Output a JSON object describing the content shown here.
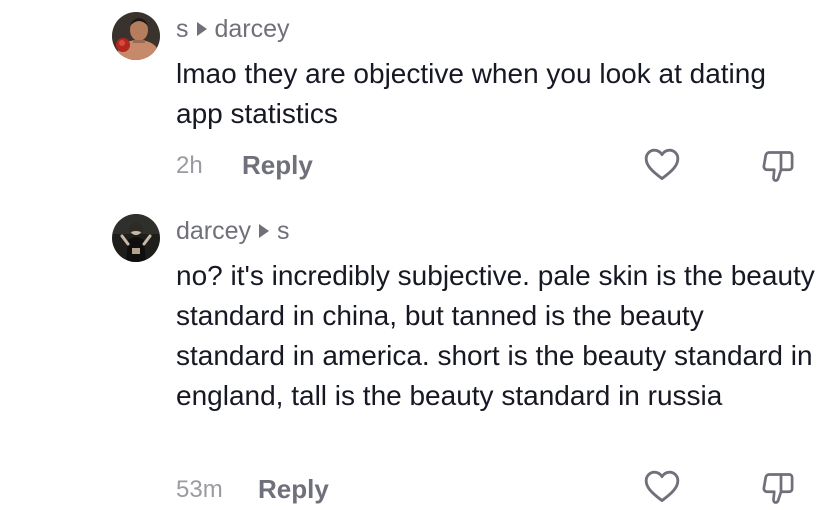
{
  "comments": [
    {
      "author": "s",
      "reply_to": "darcey",
      "text": "lmao they are objective when you look at dating app statistics",
      "time": "2h",
      "reply_label": "Reply",
      "avatar_icon": "boxer-avatar",
      "like_icon": "heart-outline-icon",
      "dislike_icon": "thumbs-down-icon"
    },
    {
      "author": "darcey",
      "reply_to": "s",
      "text": "no? it's incredibly subjective. pale skin is the beauty standard in china, but tanned is the beauty standard in america. short is the beauty standard in england, tall is the beauty standard in russia",
      "time": "53m",
      "reply_label": "Reply",
      "avatar_icon": "dark-figure-avatar",
      "like_icon": "heart-outline-icon",
      "dislike_icon": "thumbs-down-icon"
    }
  ],
  "colors": {
    "text_primary": "#161823",
    "text_secondary": "#6f7079",
    "text_meta": "#9a9ba2",
    "icon_stroke": "#6f7079",
    "background": "#ffffff"
  }
}
